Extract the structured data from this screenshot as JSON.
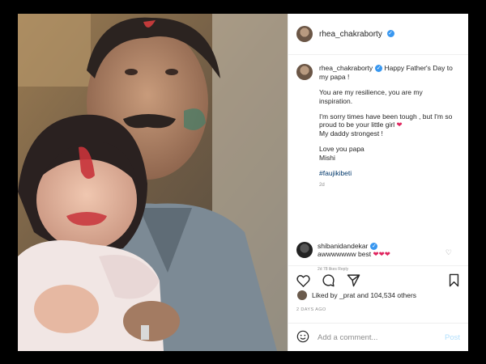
{
  "header": {
    "username": "rhea_chakraborty",
    "verified_badge": "✓"
  },
  "caption": {
    "username": "rhea_chakraborty",
    "lines_1": "Happy Father's Day to my papa !",
    "p2": "You are my resilience, you are my inspiration.",
    "p3a": "I'm sorry times have been tough , but I'm so proud to be your little girl",
    "p3b": "My daddy strongest !",
    "p4a": "Love you papa",
    "p4b": "Mishi",
    "hashtag": "#faujikibeti",
    "time": "2d",
    "heart": "❤"
  },
  "comment": {
    "username": "shibanidandekar",
    "text": "awwwwwww best",
    "hearts": "❤❤❤",
    "meta": "2d  78 likes  Reply"
  },
  "likes": {
    "text_prefix": "Liked by ",
    "user": "_prat",
    "text_mid": " and ",
    "count": "104,534",
    "text_suffix": " others"
  },
  "date": "2 DAYS AGO",
  "add_comment": {
    "placeholder": "Add a comment...",
    "post_label": "Post"
  },
  "icons": [
    "heart-icon",
    "comment-icon",
    "share-icon",
    "bookmark-icon",
    "emoji-icon",
    "more-icon"
  ],
  "colors": {
    "link": "#00376b",
    "verified": "#3897f0",
    "post_button": "#b2dffc"
  }
}
